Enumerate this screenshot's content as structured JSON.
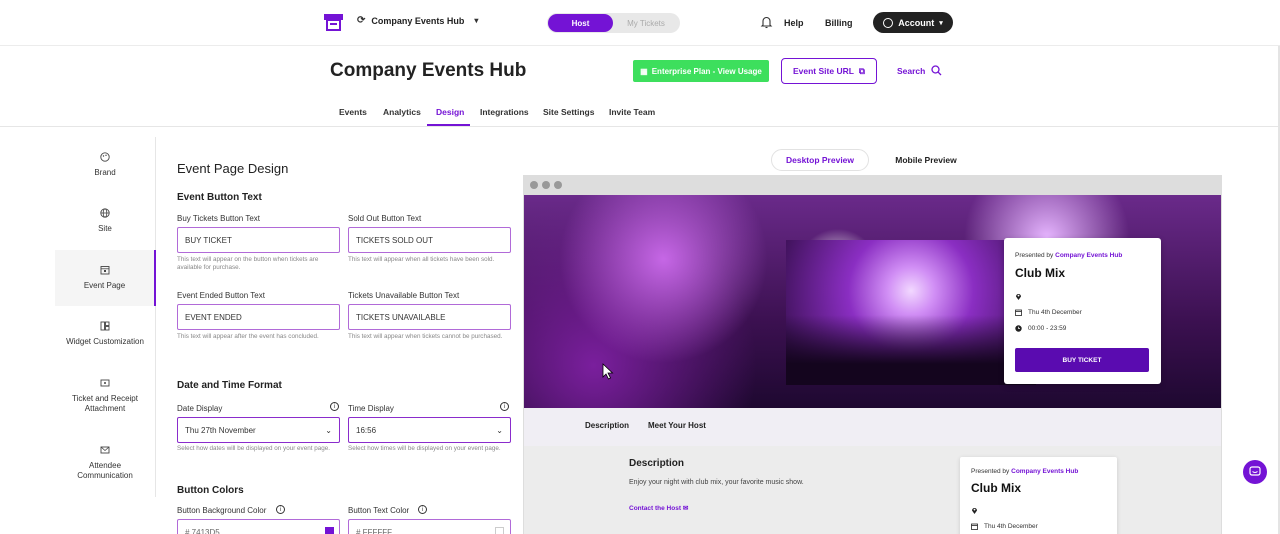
{
  "topbar": {
    "hub_name": "Company Events Hub",
    "seg_host": "Host",
    "seg_tickets": "My Tickets",
    "help": "Help",
    "billing": "Billing",
    "account": "Account"
  },
  "header": {
    "title": "Company Events Hub",
    "plan_button": "Enterprise Plan - View Usage",
    "site_url_button": "Event Site URL",
    "search": "Search"
  },
  "nav_tabs": [
    "Events",
    "Analytics",
    "Design",
    "Integrations",
    "Site Settings",
    "Invite Team"
  ],
  "active_tab": "Design",
  "sidebar": {
    "items": [
      {
        "label": "Brand",
        "icon": "palette-icon"
      },
      {
        "label": "Site",
        "icon": "globe-icon"
      },
      {
        "label": "Event Page",
        "icon": "calendar-page-icon"
      },
      {
        "label": "Widget Customization",
        "icon": "widget-icon"
      },
      {
        "label": "Ticket and Receipt Attachment",
        "icon": "ticket-icon"
      },
      {
        "label": "Attendee Communication",
        "icon": "mail-icon"
      }
    ],
    "active": "Event Page"
  },
  "form": {
    "title": "Event Page Design",
    "button_text_section": "Event Button Text",
    "buy_label": "Buy Tickets Button Text",
    "buy_value": "BUY TICKET",
    "buy_hint": "This text will appear on the button when tickets are available for purchase.",
    "soldout_label": "Sold Out Button Text",
    "soldout_value": "TICKETS SOLD OUT",
    "soldout_hint": "This text will appear when all tickets have been sold.",
    "ended_label": "Event Ended Button Text",
    "ended_value": "EVENT ENDED",
    "ended_hint": "This text will appear after the event has concluded.",
    "unavail_label": "Tickets Unavailable Button Text",
    "unavail_value": "TICKETS UNAVAILABLE",
    "unavail_hint": "This text will appear when tickets cannot be purchased.",
    "datetime_section": "Date and Time Format",
    "date_label": "Date Display",
    "date_value": "Thu 27th November",
    "date_hint": "Select how dates will be displayed on your event page.",
    "time_label": "Time Display",
    "time_value": "16:56",
    "time_hint": "Select how times will be displayed on your event page.",
    "colors_section": "Button Colors",
    "bg_color_label": "Button Background Color",
    "bg_color_value": "# 7413D5",
    "text_color_label": "Button Text Color",
    "text_color_value": "# FFFFFF"
  },
  "preview": {
    "desktop_tab": "Desktop Preview",
    "mobile_tab": "Mobile Preview",
    "presented_by": "Presented by",
    "host_name": "Company Events Hub",
    "event_title": "Club Mix",
    "date": "Thu 4th December",
    "time": "00:00 - 23:59",
    "buy_button": "BUY TICKET",
    "subnav_description": "Description",
    "subnav_host": "Meet Your Host",
    "desc_title": "Description",
    "desc_text": "Enjoy your night with club mix, your favorite music show.",
    "contact_host": "Contact the Host",
    "card2_presented_by": "Presented by",
    "card2_host": "Company Events Hub",
    "card2_title": "Club Mix",
    "card2_date": "Thu 4th December"
  },
  "colors": {
    "accent": "#7413D5",
    "plan_green": "#3DDF5D",
    "button_text": "#FFFFFF"
  }
}
